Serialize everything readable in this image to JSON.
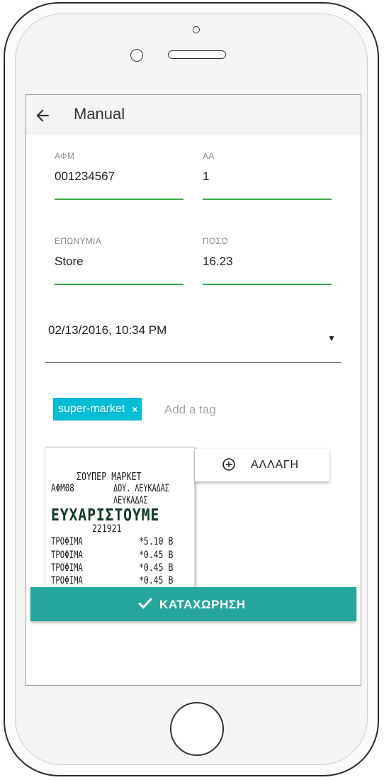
{
  "app": {
    "title": "Manual"
  },
  "form": {
    "afm": {
      "label": "ΑΦΜ",
      "value": "001234567"
    },
    "aa": {
      "label": "ΑΑ",
      "value": "1"
    },
    "eponymia": {
      "label": "ΕΠΩΝΥΜΙΑ",
      "value": "Store"
    },
    "poso": {
      "label": "ΠΟΣΟ",
      "value": "16.23"
    },
    "datetime": {
      "value": "02/13/2016, 10:34 PM"
    }
  },
  "tags": {
    "items": [
      {
        "label": "super-market",
        "remove": "×"
      }
    ],
    "placeholder": "Add a tag"
  },
  "receipt": {
    "store_name": "ΣΟΥΠΕΡ ΜΑΡΚΕΤ",
    "afm": "ΑΦΜ08",
    "doy": "ΔΟΥ. ΛΕΥΚΑΔΑΣ",
    "city": "ΛΕΥΚΑΔΑΣ",
    "thanks": "ΕΥΧΑΡΙΣΤΟΥΜΕ",
    "number": "221921",
    "lines": [
      {
        "item": "ΤΡΟΦΙΜΑ",
        "amount": "*5.10 B"
      },
      {
        "item": "ΤΡΟΦΙΜΑ",
        "amount": "*0.45 B"
      },
      {
        "item": "ΤΡΟΦΙΜΑ",
        "amount": "*0.45 B"
      },
      {
        "item": "ΤΡΟΦΙΜΑ",
        "amount": "*0.45 B"
      }
    ]
  },
  "actions": {
    "change_label": "ΑΛΛΑΓΗ",
    "submit_label": "ΚΑΤΑΧΩΡΗΣΗ"
  },
  "colors": {
    "accent_green": "#3aa84a",
    "chip": "#00bcd4",
    "submit": "#26a69a"
  },
  "icons": {
    "back": "arrow-left-icon",
    "change": "plus-circle-icon",
    "submit": "check-icon",
    "dropdown": "caret-down-icon"
  }
}
